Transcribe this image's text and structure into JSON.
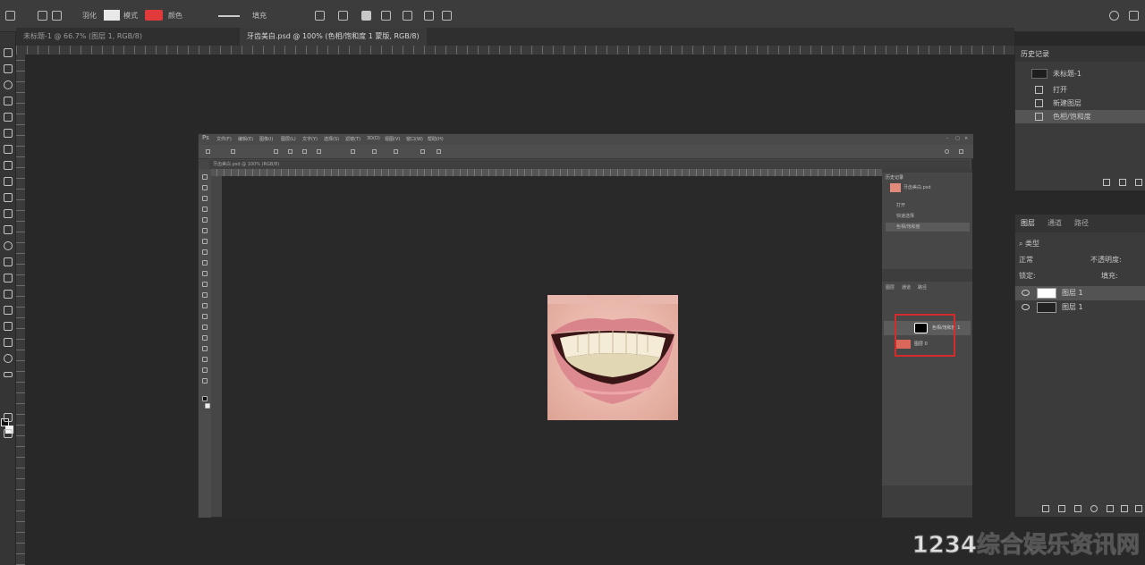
{
  "options_bar": {
    "feather_label": "羽化",
    "mode_label": "模式",
    "color_label": "颜色",
    "fill_label": "填充"
  },
  "doc_tabs": [
    {
      "label": "未标题-1 @ 66.7% (图层 1, RGB/8)"
    },
    {
      "label": "牙齿美白.psd @ 100% (色相/饱和度 1 蒙版, RGB/8)"
    }
  ],
  "inner_window": {
    "menu": [
      "文件(F)",
      "编辑(E)",
      "图像(I)",
      "图层(L)",
      "文字(Y)",
      "选择(S)",
      "滤镜(T)",
      "3D(D)",
      "视图(V)",
      "窗口(W)",
      "帮助(H)"
    ],
    "tab_label": "牙齿美白.psd @ 100% (RGB/8)",
    "history": {
      "title": "历史记录",
      "items": [
        "牙齿美白.psd",
        "打开",
        "快速选择",
        "色相/饱和度"
      ]
    },
    "layers": {
      "tabs": [
        "图层",
        "通道",
        "路径"
      ],
      "rows": [
        "色相/饱和度 1",
        "图层 0"
      ]
    }
  },
  "history_panel": {
    "title": "历史记录",
    "snapshot": "未标题-1",
    "items": [
      "打开",
      "新建图层",
      "色相/饱和度"
    ]
  },
  "layers_panel": {
    "tabs": [
      "图层",
      "通道",
      "路径"
    ],
    "filter_label": "类型",
    "blend_mode": "正常",
    "opacity_label": "不透明度:",
    "lock_label": "锁定:",
    "fill_label": "填充:",
    "layers": [
      {
        "name": "图层 1",
        "selected": true
      },
      {
        "name": "图层 1",
        "selected": false
      }
    ]
  },
  "watermark": "1234综合娱乐资讯网",
  "colors": {
    "accent_red": "#d62b2b",
    "fg_color": "#111111",
    "bg_color": "#f2f2f2"
  }
}
